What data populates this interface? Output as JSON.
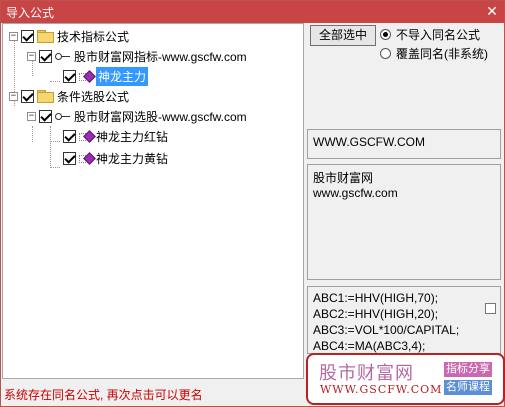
{
  "window": {
    "title": "导入公式",
    "close_glyph": "✕"
  },
  "tree": {
    "groups": [
      {
        "label": "技术指标公式",
        "sites": [
          {
            "label": "股市财富网指标-www.gscfw.com",
            "formulas": [
              "神龙主力"
            ]
          }
        ]
      },
      {
        "label": "条件选股公式",
        "sites": [
          {
            "label": "股市财富网选股-www.gscfw.com",
            "formulas": [
              "神龙主力红钻",
              "神龙主力黄钻"
            ]
          }
        ]
      }
    ],
    "selected_formula": "神龙主力"
  },
  "controls": {
    "select_all_label": "全部选中",
    "radio_skip_label": "不导入同名公式",
    "radio_overwrite_label": "覆盖同名(非系统)",
    "radio_selected": "skip"
  },
  "url_box": {
    "text": "WWW.GSCFW.COM"
  },
  "desc_box": {
    "line1": "股市财富网",
    "line2": "www.gscfw.com"
  },
  "code_box": {
    "lines": [
      "ABC1:=HHV(HIGH,70);",
      "ABC2:=HHV(HIGH,20);",
      "ABC3:=VOL*100/CAPITAL;",
      "ABC4:=MA(ABC3,4);"
    ]
  },
  "status_text": "系统存在同名公式, 再次点击可以更名",
  "watermark": {
    "name": "股市财富网",
    "url": "WWW.GSCFW.COM",
    "tag1": "指标分享",
    "tag2": "名师课程"
  },
  "colors": {
    "title_bar": "#c94545",
    "selection": "#3399ff",
    "status": "#cc0000",
    "watermark_border": "#b82222"
  }
}
